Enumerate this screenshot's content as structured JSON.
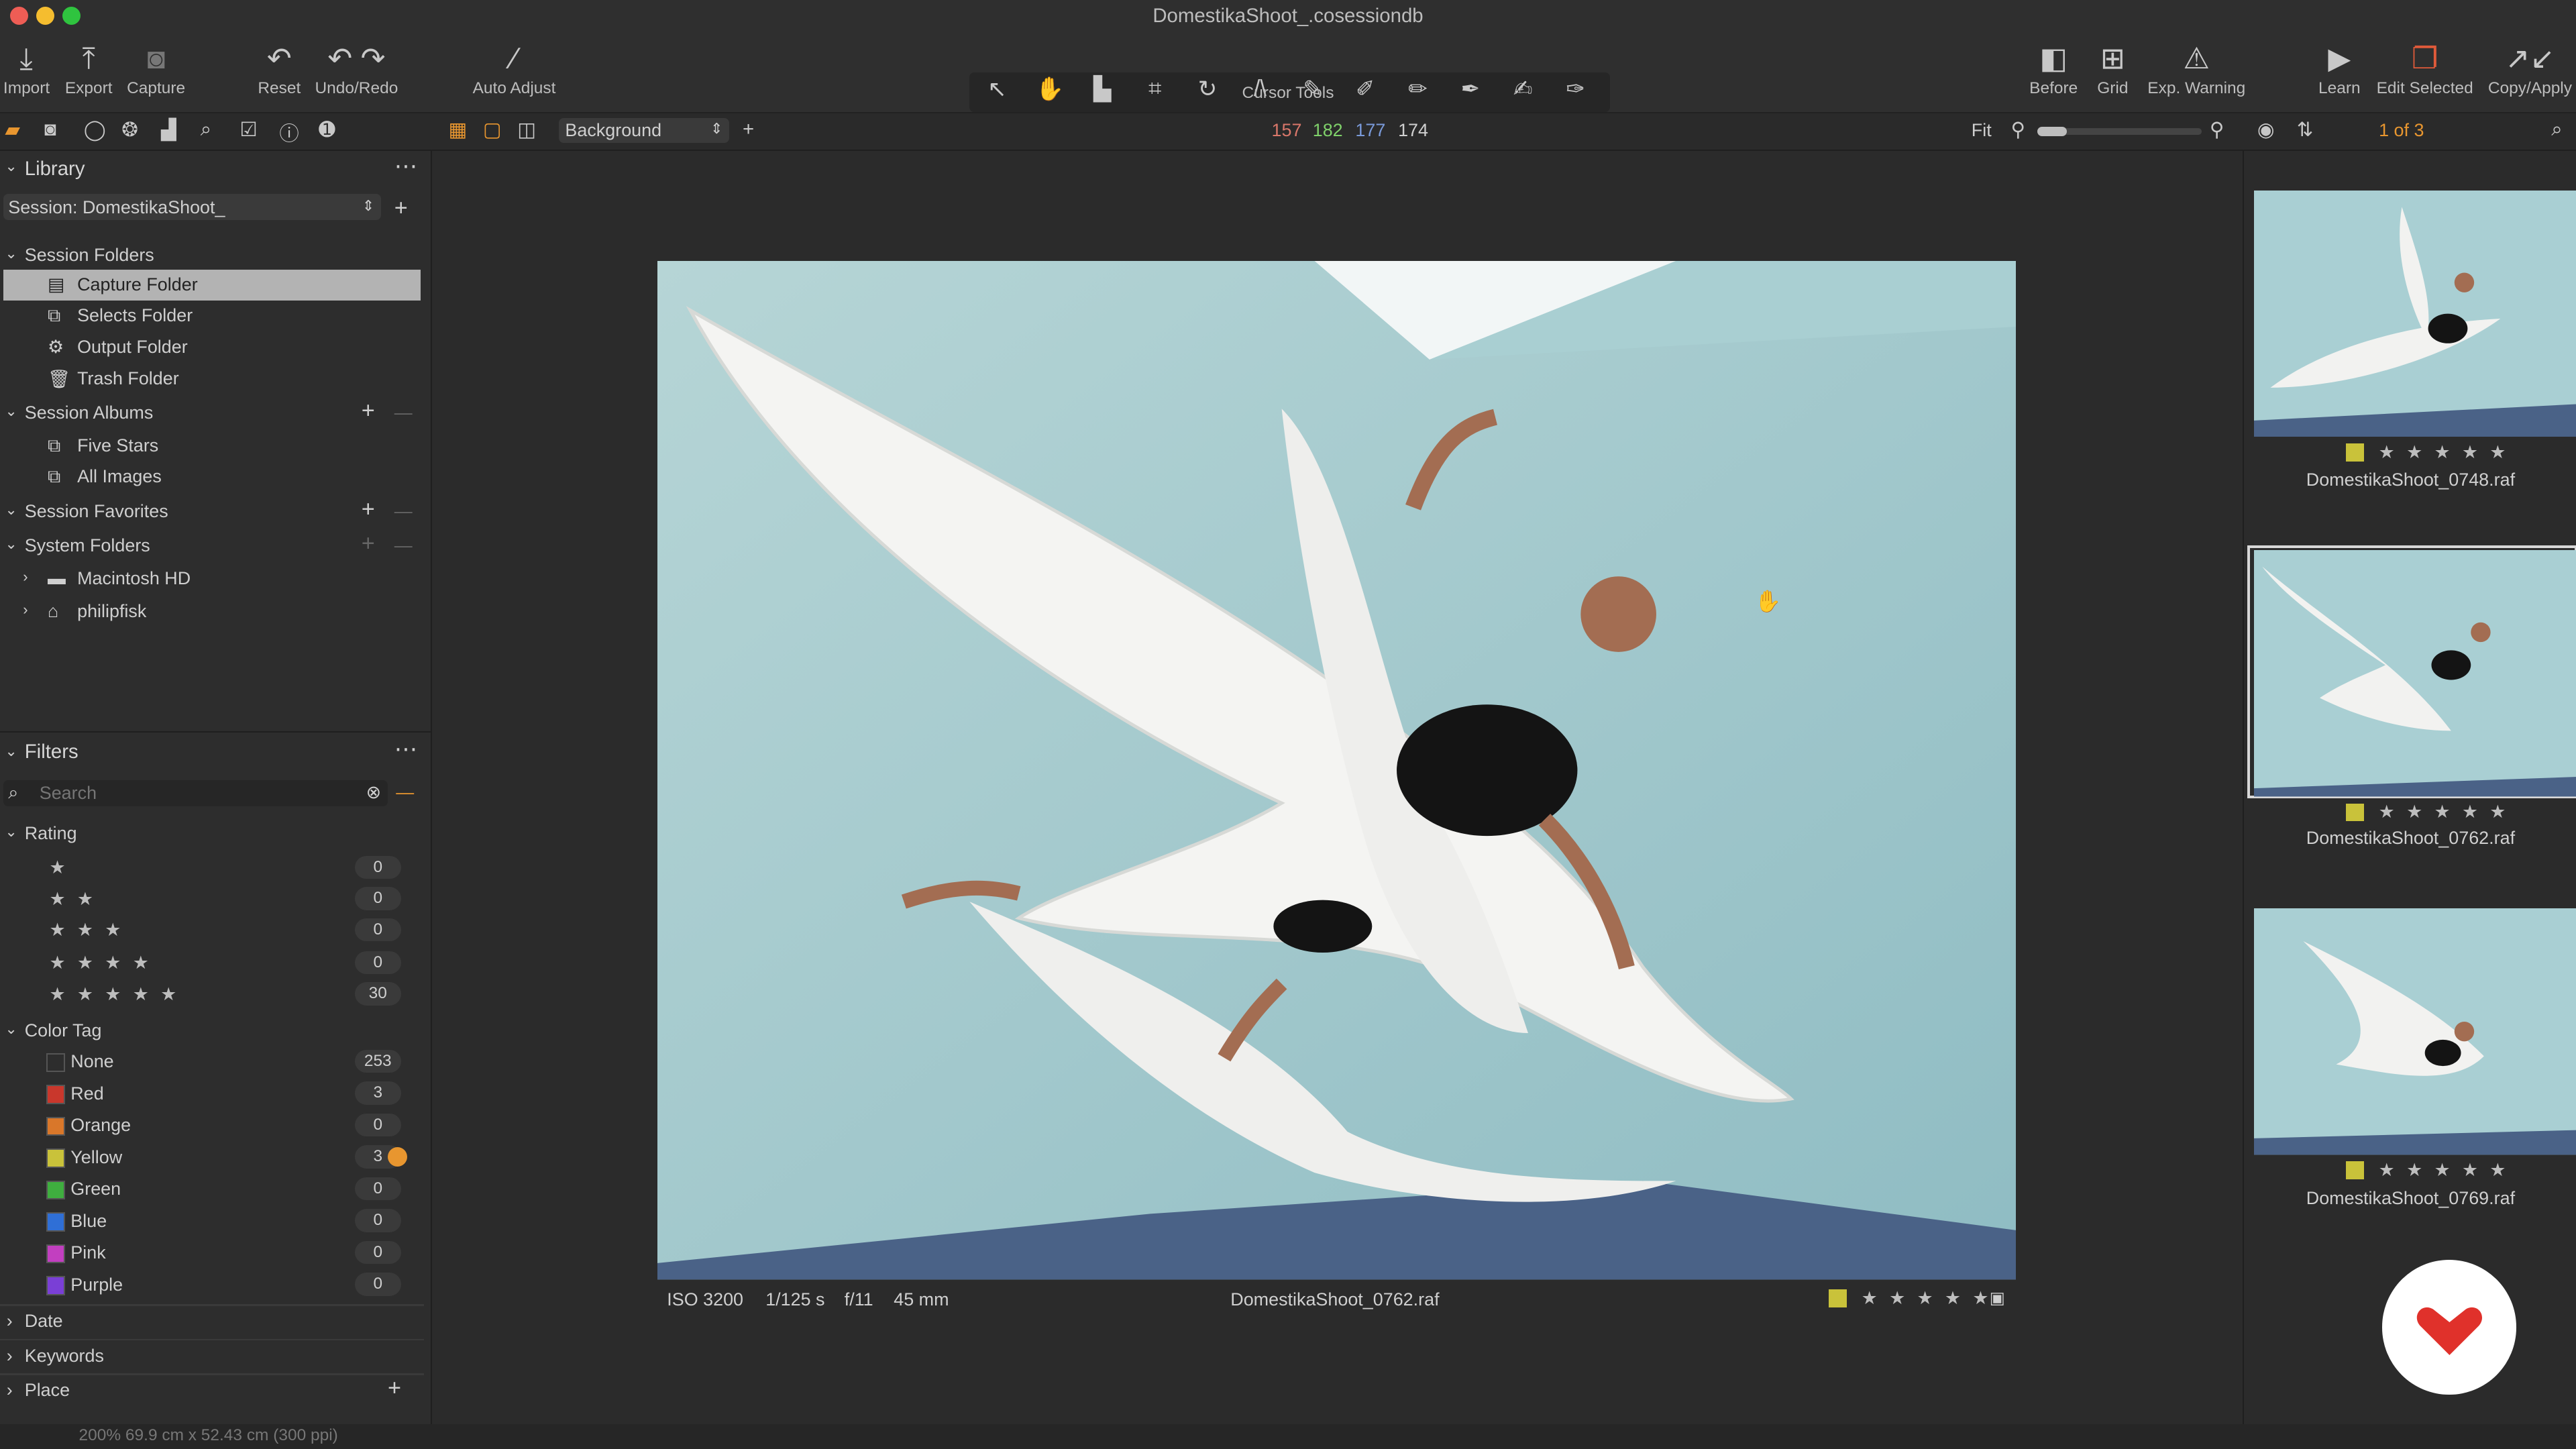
{
  "window": {
    "title": "DomestikaShoot_.cosessiondb"
  },
  "toolbar": {
    "import": "Import",
    "export": "Export",
    "capture": "Capture",
    "reset": "Reset",
    "undo_redo": "Undo/Redo",
    "auto_adjust": "Auto Adjust",
    "cursor_tools": "Cursor Tools",
    "before": "Before",
    "grid": "Grid",
    "exp_warning": "Exp. Warning",
    "learn": "Learn",
    "edit_selected": "Edit Selected",
    "copy_apply": "Copy/Apply"
  },
  "subbar": {
    "style_select": "Background",
    "readout": {
      "r": "157",
      "g": "182",
      "b": "177",
      "l": "174"
    },
    "fit": "Fit",
    "counter": "1 of 3"
  },
  "library": {
    "title": "Library",
    "session_select": "Session: DomestikaShoot_",
    "session_folders": {
      "title": "Session Folders",
      "items": [
        "Capture Folder",
        "Selects Folder",
        "Output Folder",
        "Trash Folder"
      ]
    },
    "session_albums": {
      "title": "Session Albums",
      "items": [
        "Five Stars",
        "All Images"
      ]
    },
    "session_favorites": {
      "title": "Session Favorites"
    },
    "system_folders": {
      "title": "System Folders",
      "items": [
        "Macintosh HD",
        "philipfisk"
      ]
    }
  },
  "filters": {
    "title": "Filters",
    "search_placeholder": "Search",
    "rating": {
      "title": "Rating",
      "rows": [
        {
          "stars": "★",
          "count": "0"
        },
        {
          "stars": "★ ★",
          "count": "0"
        },
        {
          "stars": "★ ★ ★",
          "count": "0"
        },
        {
          "stars": "★ ★ ★ ★",
          "count": "0"
        },
        {
          "stars": "★ ★ ★ ★ ★",
          "count": "30"
        }
      ]
    },
    "color_tag": {
      "title": "Color Tag",
      "rows": [
        {
          "label": "None",
          "count": "253",
          "color": "#2d2d2d"
        },
        {
          "label": "Red",
          "count": "3",
          "color": "#c9372c"
        },
        {
          "label": "Orange",
          "count": "0",
          "color": "#d9772a"
        },
        {
          "label": "Yellow",
          "count": "3",
          "color": "#c9c23a"
        },
        {
          "label": "Green",
          "count": "0",
          "color": "#3fae3f"
        },
        {
          "label": "Blue",
          "count": "0",
          "color": "#2f6fd6"
        },
        {
          "label": "Pink",
          "count": "0",
          "color": "#c23fc0"
        },
        {
          "label": "Purple",
          "count": "0",
          "color": "#7a3fd6"
        }
      ]
    },
    "date": "Date",
    "keywords": "Keywords",
    "place": "Place"
  },
  "viewer": {
    "iso": "ISO 3200",
    "shutter": "1/125 s",
    "aperture": "f/11",
    "focal": "45 mm",
    "filename": "DomestikaShoot_0762.raf",
    "stars": "★ ★ ★ ★ ★"
  },
  "browser": {
    "items": [
      {
        "name": "DomestikaShoot_0748.raf",
        "stars": "★ ★ ★ ★ ★"
      },
      {
        "name": "DomestikaShoot_0762.raf",
        "stars": "★ ★ ★ ★ ★"
      },
      {
        "name": "DomestikaShoot_0769.raf",
        "stars": "★ ★ ★ ★ ★"
      }
    ]
  },
  "status": {
    "text": "200%    69.9 cm x 52.43 cm (300 ppi)"
  },
  "colors": {
    "accent": "#e8962f",
    "panel": "#2d2d2d",
    "yellow_tag": "#c9c23a",
    "brand_red": "#e0312b"
  }
}
